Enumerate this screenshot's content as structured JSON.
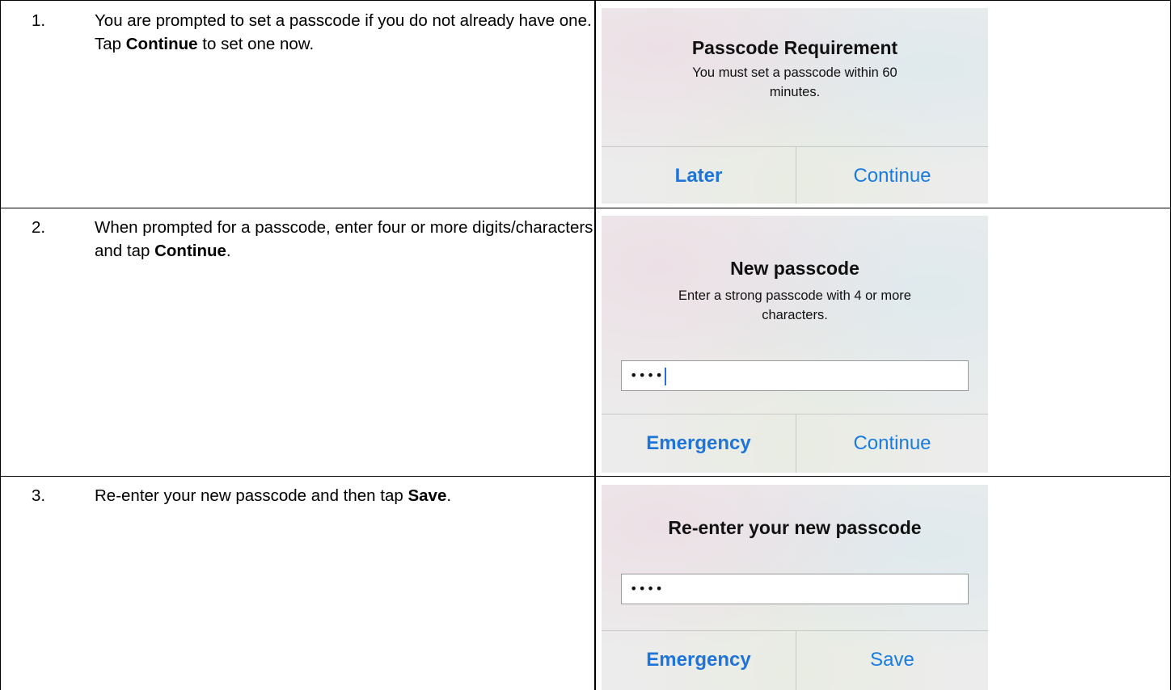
{
  "steps": [
    {
      "number": "1.",
      "text_before": "You are prompted to set a passcode if you do not already have one.  Tap ",
      "bold": "Continue",
      "text_after": " to set one now.",
      "screenshot": {
        "title": "Passcode Requirement",
        "message_line1": "You must set a passcode within 60",
        "message_line2": "minutes.",
        "left_button": "Later",
        "right_button": "Continue"
      }
    },
    {
      "number": "2.",
      "text_before": "When prompted for a passcode, enter four or more digits/characters and tap ",
      "bold": "Continue",
      "text_after": ".",
      "screenshot": {
        "title": "New passcode",
        "message_line1": "Enter a strong passcode with 4 or more",
        "message_line2": "characters.",
        "field_value": "••••",
        "left_button": "Emergency",
        "right_button": "Continue"
      }
    },
    {
      "number": "3.",
      "text_before": "Re-enter your new passcode and then tap ",
      "bold": "Save",
      "text_after": ".",
      "screenshot": {
        "title": "Re-enter your new passcode",
        "field_value": "••••",
        "left_button": "Emergency",
        "right_button": "Save"
      }
    }
  ]
}
